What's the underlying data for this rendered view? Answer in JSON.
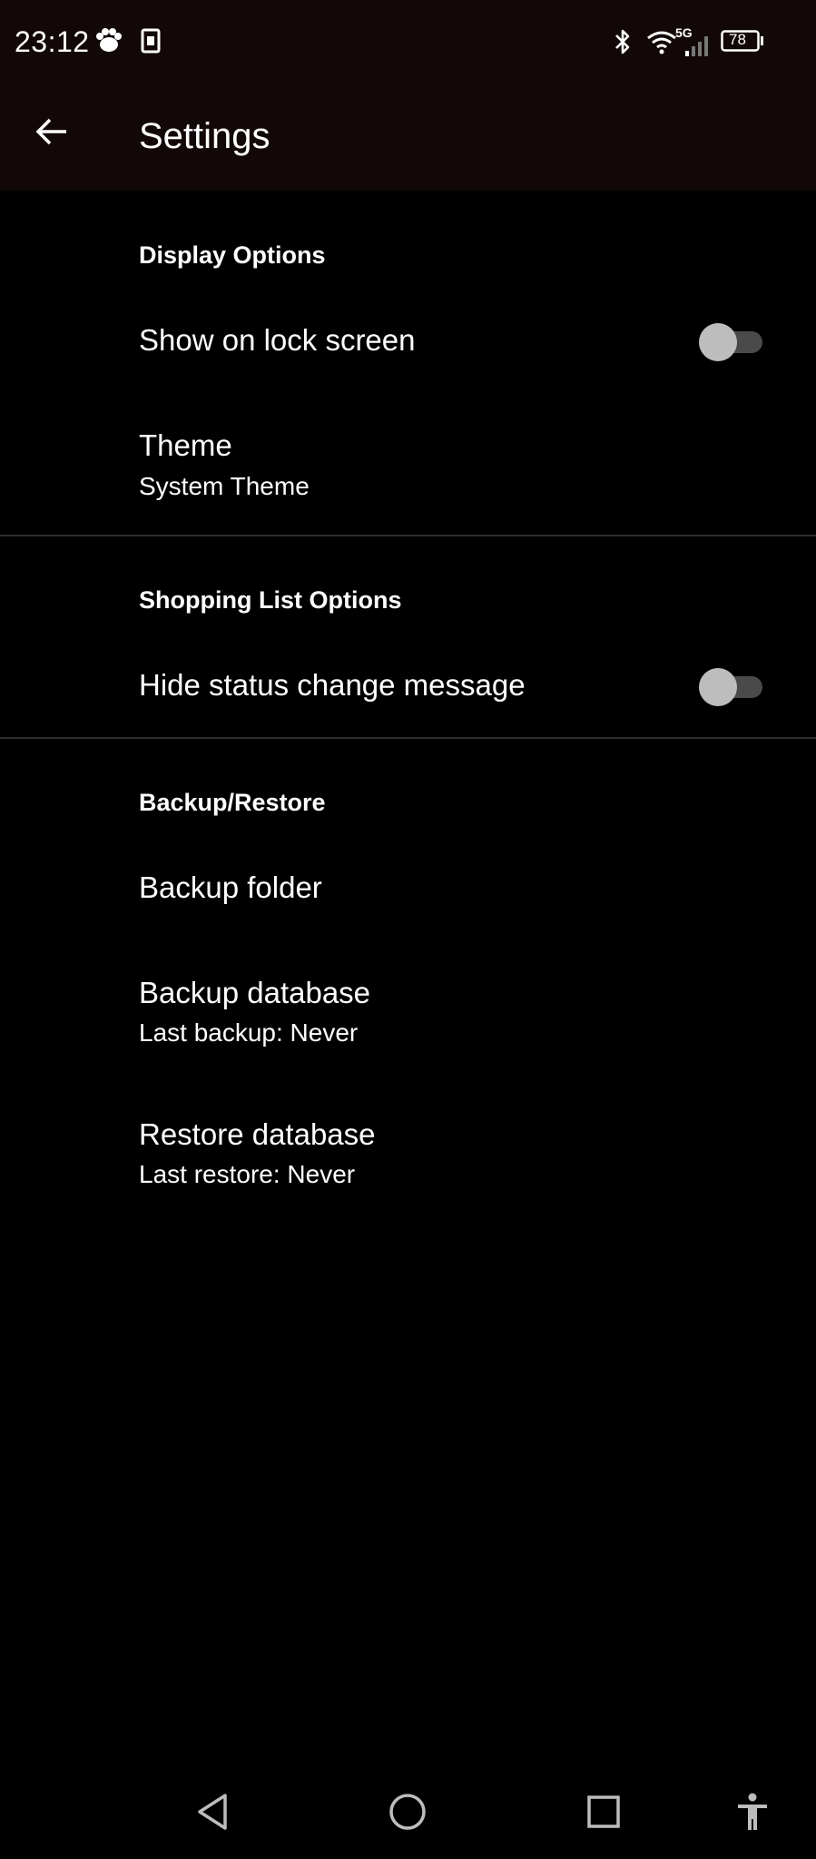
{
  "status_bar": {
    "time": "23:12",
    "network_label": "5G",
    "battery_level": "78",
    "icons": [
      "paw-notification-icon",
      "sim-card-icon",
      "bluetooth-icon",
      "wifi-icon",
      "cell-signal-icon",
      "battery-icon"
    ]
  },
  "app_bar": {
    "title": "Settings",
    "back_icon": "arrow-left-icon"
  },
  "sections": {
    "display": {
      "header": "Display Options",
      "show_lock_screen": {
        "title": "Show on lock screen",
        "checked": false
      },
      "theme": {
        "title": "Theme",
        "summary": "System Theme"
      }
    },
    "shopping": {
      "header": "Shopping List Options",
      "hide_status": {
        "title": "Hide status change message",
        "checked": false
      }
    },
    "backup": {
      "header": "Backup/Restore",
      "backup_folder": {
        "title": "Backup folder"
      },
      "backup_database": {
        "title": "Backup database",
        "summary": "Last backup: Never"
      },
      "restore_database": {
        "title": "Restore database",
        "summary": "Last restore: Never"
      }
    }
  },
  "nav_bar": {
    "icons": [
      "back-triangle-icon",
      "home-circle-icon",
      "recents-square-icon",
      "accessibility-icon"
    ]
  },
  "colors": {
    "background": "#000000",
    "topbar": "#130808",
    "text": "#ffffff",
    "switch_track": "#4a4a4a",
    "switch_thumb": "#bdbdbd",
    "divider": "#2e2e2e"
  }
}
